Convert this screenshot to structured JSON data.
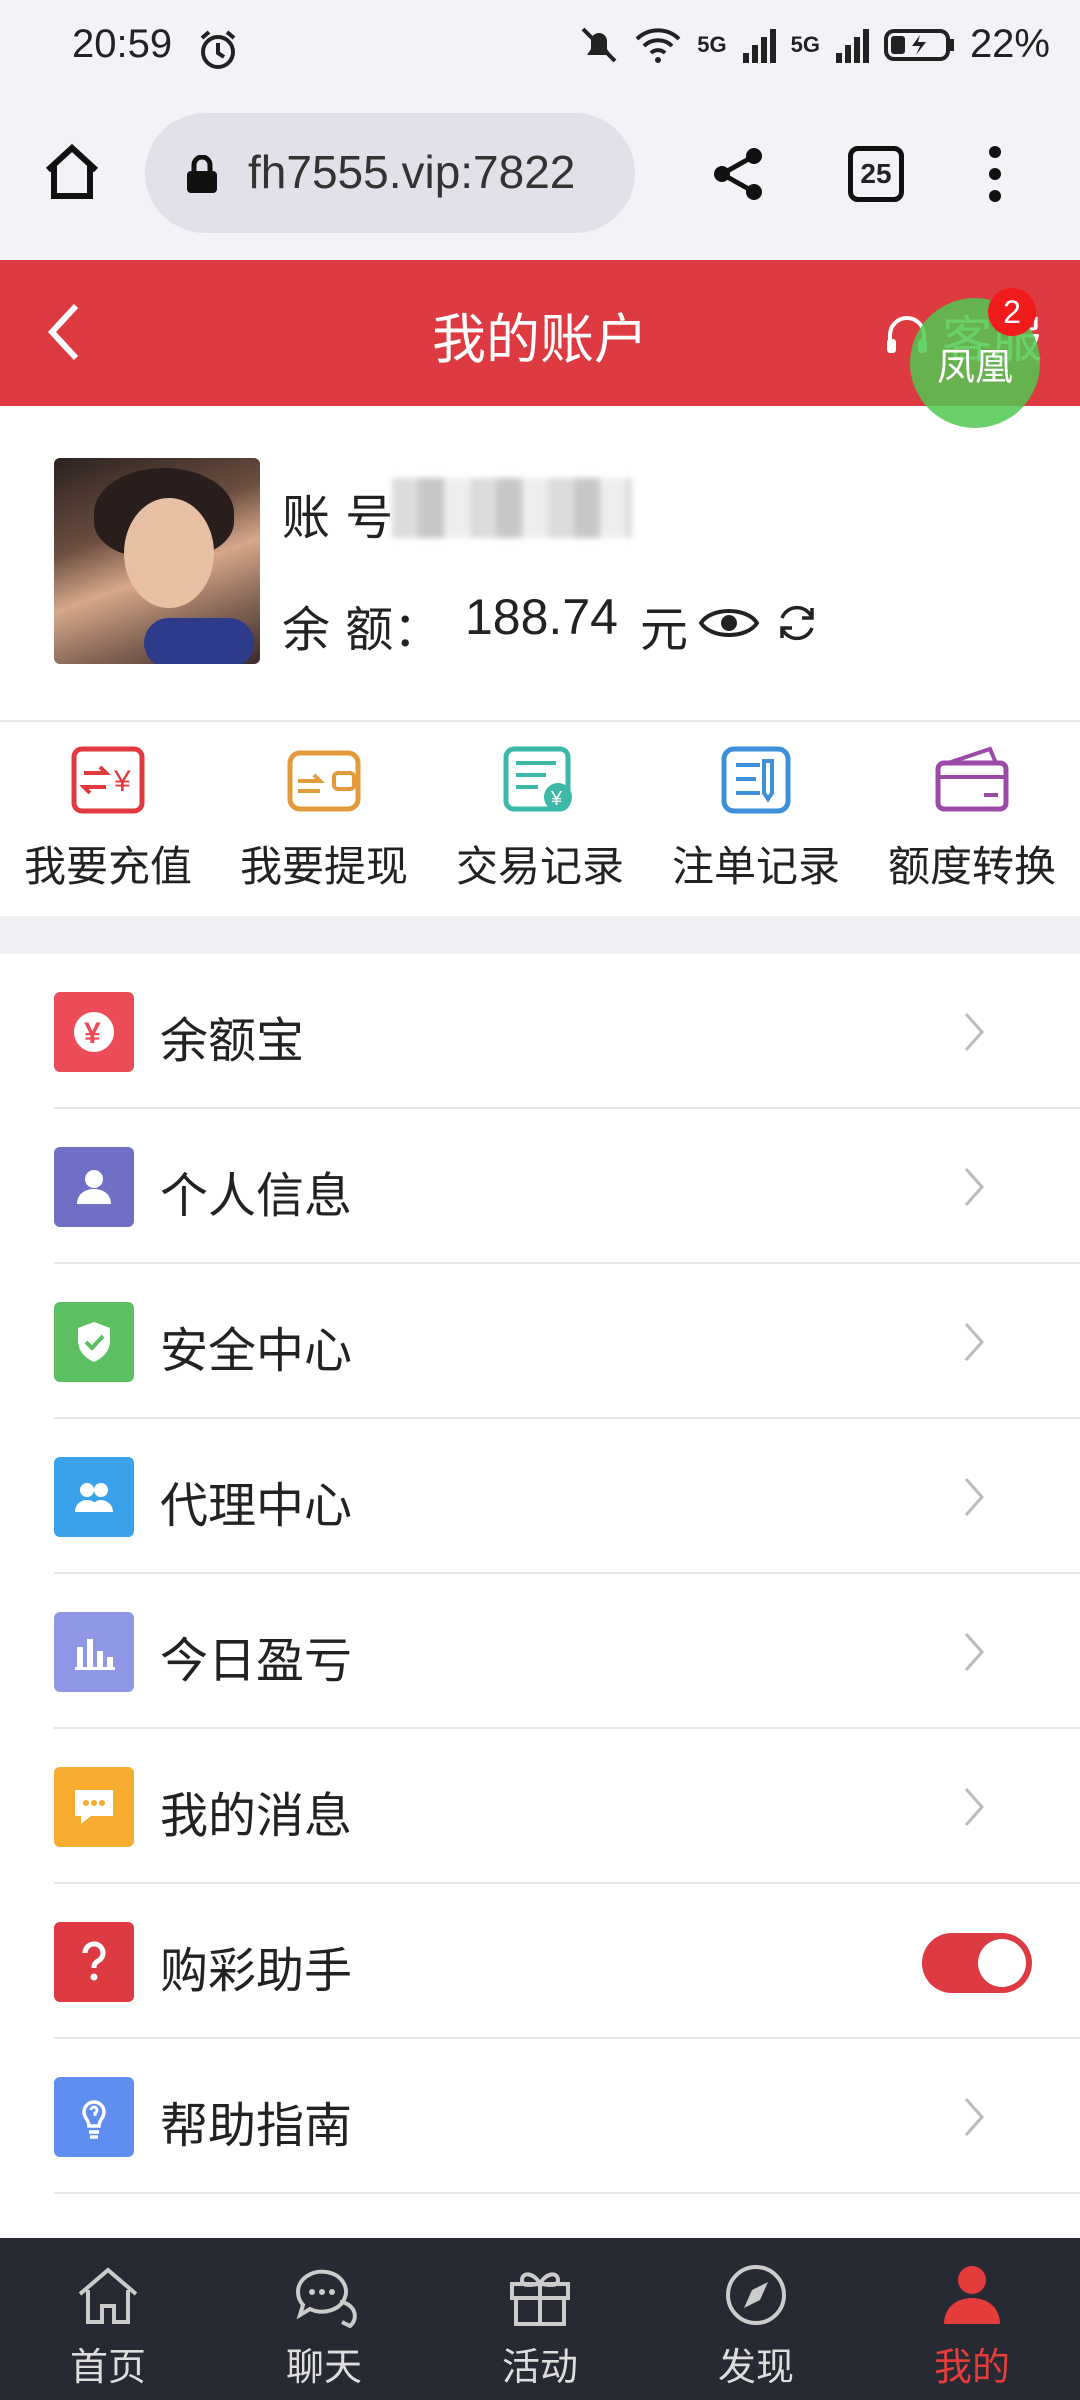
{
  "status": {
    "time": "20:59",
    "battery": "22%",
    "network1": "5G",
    "network2": "5G"
  },
  "browser": {
    "url": "fh7555.vip:7822",
    "tab_count": "25"
  },
  "header": {
    "title": "我的账户",
    "service_label": "客服",
    "bubble_label": "凤凰",
    "badge": "2"
  },
  "profile": {
    "account_label": "账 号",
    "balance_label": "余 额：",
    "balance_value": "188.74",
    "balance_unit": "元"
  },
  "quick_actions": [
    {
      "label": "我要充值",
      "icon": "recharge-icon",
      "color": "#e0393e"
    },
    {
      "label": "我要提现",
      "icon": "withdraw-icon",
      "color": "#e39a3b"
    },
    {
      "label": "交易记录",
      "icon": "transaction-record-icon",
      "color": "#3bb8a8"
    },
    {
      "label": "注单记录",
      "icon": "bet-record-icon",
      "color": "#3d8fd8"
    },
    {
      "label": "额度转换",
      "icon": "wallet-transfer-icon",
      "color": "#9b4aa8"
    }
  ],
  "menu": [
    {
      "label": "余额宝",
      "icon": "yuebao-icon",
      "color": "#ec4c58"
    },
    {
      "label": "个人信息",
      "icon": "person-icon",
      "color": "#6f6fc6"
    },
    {
      "label": "安全中心",
      "icon": "shield-icon",
      "color": "#5cbf62"
    },
    {
      "label": "代理中心",
      "icon": "agents-icon",
      "color": "#3aa2ea"
    },
    {
      "label": "今日盈亏",
      "icon": "bar-chart-icon",
      "color": "#8f97e6"
    },
    {
      "label": "我的消息",
      "icon": "message-icon",
      "color": "#f5ac2f"
    },
    {
      "label": "购彩助手",
      "icon": "question-icon",
      "color": "#dd3a42"
    },
    {
      "label": "帮助指南",
      "icon": "help-bulb-icon",
      "color": "#5f8ef0"
    }
  ],
  "bottom_nav": [
    {
      "label": "首页",
      "icon": "home-icon"
    },
    {
      "label": "聊天",
      "icon": "chat-icon"
    },
    {
      "label": "活动",
      "icon": "gift-icon"
    },
    {
      "label": "发现",
      "icon": "compass-icon"
    },
    {
      "label": "我的",
      "icon": "user-icon"
    }
  ]
}
